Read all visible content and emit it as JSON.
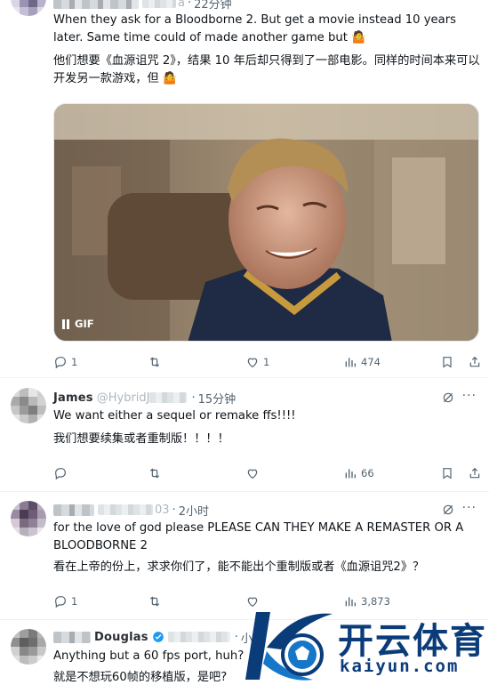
{
  "tweets": [
    {
      "author_handle_visible": "a",
      "time": "22分钟",
      "text_en": "When they ask for a Bloodborne 2. But get a movie instead 10 years later. Same time could of made another game but 🤷",
      "text_cn": "他们想要《血源诅咒 2》，结果 10 年后却只得到了一部电影。同样的时间本来可以开发另一款游戏，但 🤷",
      "media_badge": "GIF",
      "stats": {
        "replies": "1",
        "retweets": "",
        "likes": "1",
        "views": "474"
      }
    },
    {
      "author_name": "James",
      "author_handle_visible": "@HybridJ",
      "time": "15分钟",
      "text_en": "We want either a sequel or remake ffs!!!!",
      "text_cn": "我们想要续集或者重制版！！！！",
      "stats": {
        "replies": "",
        "retweets": "",
        "likes": "",
        "views": "66"
      }
    },
    {
      "author_handle_visible": "03",
      "time": "2小时",
      "text_en": "for the love of god please PLEASE CAN THEY MAKE A REMASTER OR A BLOODBORNE 2",
      "text_cn": "看在上帝的份上，求求你们了，能不能出个重制版或者《血源诅咒2》？",
      "stats": {
        "replies": "1",
        "retweets": "",
        "likes": "",
        "views": "3,873"
      }
    },
    {
      "author_name": "Douglas",
      "time": "小时",
      "text_en": "Anything but a 60 fps port, huh?",
      "text_cn": "就是不想玩60帧的移植版，是吧?"
    }
  ],
  "header_dot": "·",
  "more_icon": "···",
  "watermark": {
    "cn": "开云体育",
    "en": "kaiyun.com"
  },
  "colors": {
    "text": "#0f1419",
    "muted": "#536471",
    "divider": "#eff3f4",
    "watermark": "#0b3c7a",
    "verified": "#1d9bf0"
  },
  "icons": [
    "reply-icon",
    "retweet-icon",
    "like-icon",
    "views-icon",
    "bookmark-icon",
    "share-icon",
    "grok-icon",
    "more-icon",
    "pause-icon",
    "verified-icon"
  ]
}
